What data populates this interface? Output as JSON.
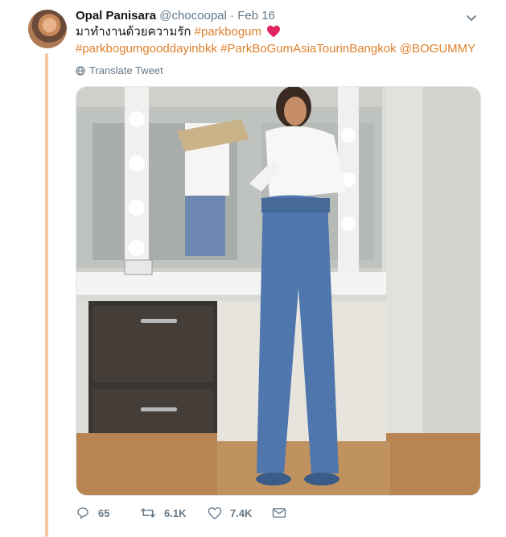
{
  "tweet": {
    "author_name": "Opal Panisara",
    "handle": "@chocoopal",
    "separator": "·",
    "date": "Feb 16",
    "text_thai": "มาทำงานด้วยความรัก",
    "hashtag_1": "#parkbogum",
    "heart_emoji_color": "#e0245e",
    "hashtag_2": "#parkbogumgooddayinbkk",
    "hashtag_3": "#ParkBoGumAsiaTourinBangkok",
    "mention": "@BOGUMMY",
    "translate_label": "Translate Tweet"
  },
  "actions": {
    "reply_count": "65",
    "retweet_count": "6.1K",
    "like_count": "7.4K"
  },
  "colors": {
    "link": "#e0802b",
    "thread": "#f6c9a5",
    "muted": "#657786"
  },
  "icons": [
    "globe-icon",
    "reply-icon",
    "retweet-icon",
    "heart-icon",
    "dm-icon",
    "caret-down-icon"
  ]
}
